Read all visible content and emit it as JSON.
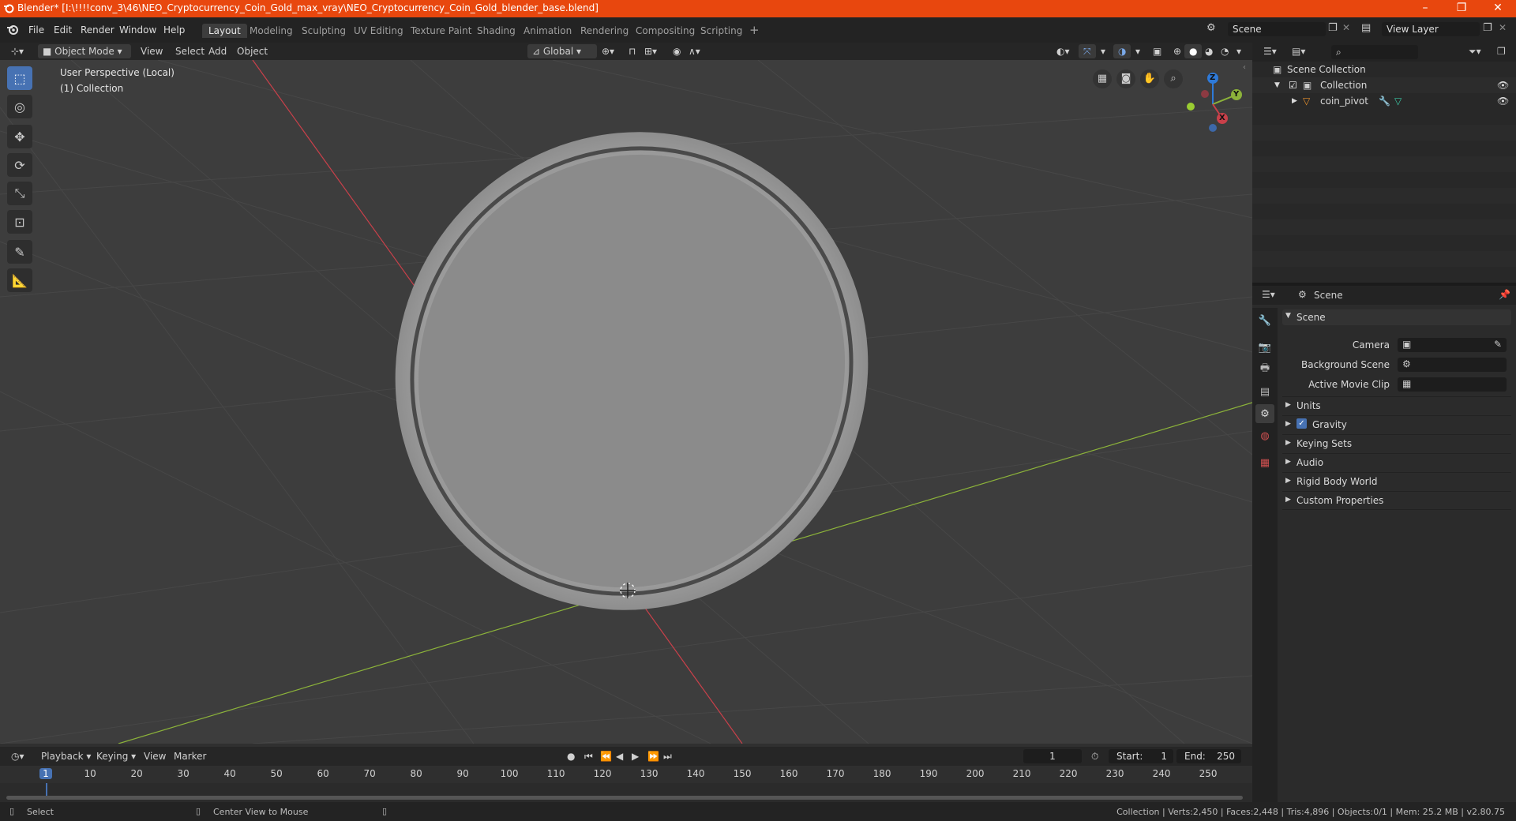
{
  "window": {
    "title": "Blender* [I:\\!!!!conv_3\\46\\NEO_Cryptocurrency_Coin_Gold_max_vray\\NEO_Cryptocurrency_Coin_Gold_blender_base.blend]",
    "minimize": "–",
    "maximize": "❐",
    "close": "✕"
  },
  "menu": [
    "File",
    "Edit",
    "Render",
    "Window",
    "Help"
  ],
  "workspaces": [
    "Layout",
    "Modeling",
    "Sculpting",
    "UV Editing",
    "Texture Paint",
    "Shading",
    "Animation",
    "Rendering",
    "Compositing",
    "Scripting"
  ],
  "add_workspace": "+",
  "scene_field": "Scene",
  "view_layer_field": "View Layer",
  "viewport_header": {
    "mode": "Object Mode",
    "menus": [
      "View",
      "Select",
      "Add",
      "Object"
    ],
    "transform": "Global"
  },
  "viewport": {
    "perspective": "User Perspective (Local)",
    "collection": "(1) Collection",
    "gizmo": {
      "z": "Z",
      "y": "Y",
      "x": "X"
    }
  },
  "outliner": {
    "root": "Scene Collection",
    "collection": "Collection",
    "object": "coin_pivot"
  },
  "properties": {
    "header": "Scene",
    "panel": "Scene",
    "fields": [
      {
        "label": "Camera"
      },
      {
        "label": "Background Scene"
      },
      {
        "label": "Active Movie Clip"
      }
    ],
    "sections": [
      "Units",
      "Gravity",
      "Keying Sets",
      "Audio",
      "Rigid Body World",
      "Custom Properties"
    ]
  },
  "timeline": {
    "menus": [
      "Playback",
      "Keying",
      "View",
      "Marker"
    ],
    "current_frame": "1",
    "start_label": "Start:",
    "start": "1",
    "end_label": "End:",
    "end": "250",
    "ruler": [
      "1",
      "10",
      "20",
      "30",
      "40",
      "50",
      "60",
      "70",
      "80",
      "90",
      "100",
      "110",
      "120",
      "130",
      "140",
      "150",
      "160",
      "170",
      "180",
      "190",
      "200",
      "210",
      "220",
      "230",
      "240",
      "250"
    ]
  },
  "status": {
    "select": "Select",
    "center": "Center View to Mouse",
    "stats": "Collection | Verts:2,450 | Faces:2,448 | Tris:4,896 | Objects:0/1 | Mem: 25.2 MB | v2.80.75"
  },
  "colors": {
    "titlebar": "#e8470e",
    "accent": "#4772b3",
    "x_axis": "#c9404a",
    "y_axis": "#8cb33a"
  }
}
